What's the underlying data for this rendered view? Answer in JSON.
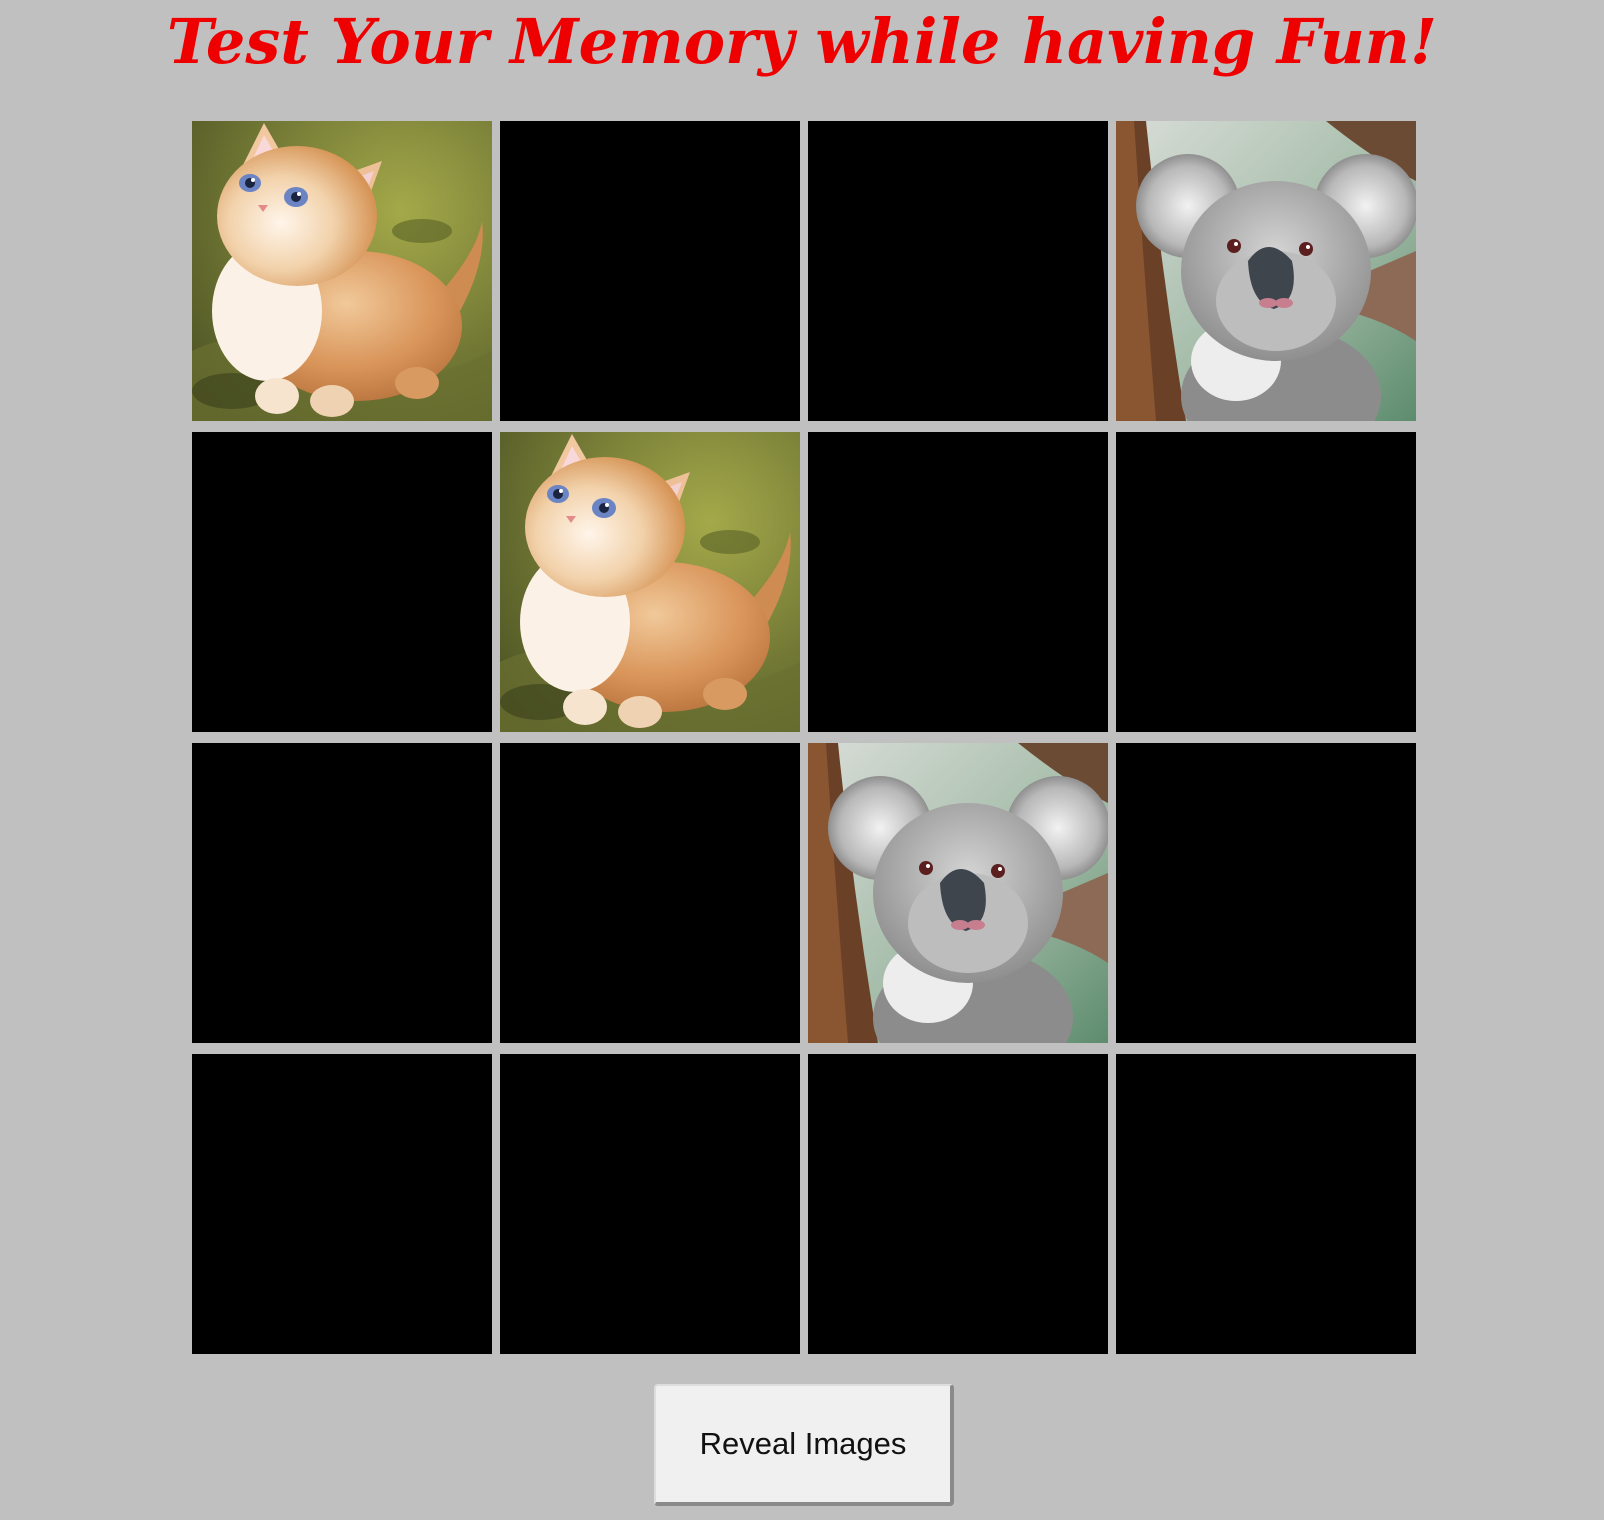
{
  "page": {
    "title": "Test Your Memory while having Fun!",
    "background": "#c0c0c0",
    "title_color": "#ee0000"
  },
  "board": {
    "rows": 4,
    "columns": 4,
    "hidden_card_color": "#000000",
    "cards": [
      {
        "revealed": true,
        "image": "kitten"
      },
      {
        "revealed": false,
        "image": ""
      },
      {
        "revealed": false,
        "image": ""
      },
      {
        "revealed": true,
        "image": "koala"
      },
      {
        "revealed": false,
        "image": ""
      },
      {
        "revealed": true,
        "image": "kitten"
      },
      {
        "revealed": false,
        "image": ""
      },
      {
        "revealed": false,
        "image": ""
      },
      {
        "revealed": false,
        "image": ""
      },
      {
        "revealed": false,
        "image": ""
      },
      {
        "revealed": true,
        "image": "koala"
      },
      {
        "revealed": false,
        "image": ""
      },
      {
        "revealed": false,
        "image": ""
      },
      {
        "revealed": false,
        "image": ""
      },
      {
        "revealed": false,
        "image": ""
      },
      {
        "revealed": false,
        "image": ""
      }
    ]
  },
  "controls": {
    "reveal_label": "Reveal Images"
  }
}
